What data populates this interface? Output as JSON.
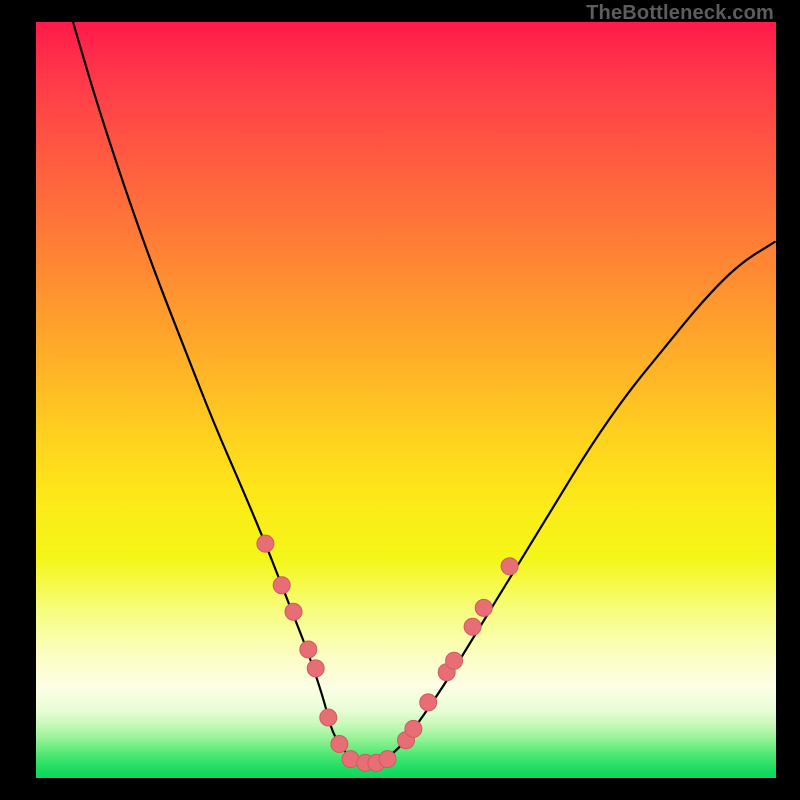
{
  "attribution": "TheBottleneck.com",
  "colors": {
    "background": "#000000",
    "curve": "#000000",
    "dot_fill": "#e76e74",
    "dot_stroke": "#d15a60"
  },
  "chart_data": {
    "type": "line",
    "title": "",
    "xlabel": "",
    "ylabel": "",
    "xlim": [
      0,
      100
    ],
    "ylim": [
      0,
      100
    ],
    "series": [
      {
        "name": "bottleneck-curve",
        "x": [
          5,
          8,
          12,
          16,
          20,
          24,
          28,
          31,
          33,
          35,
          37,
          39,
          40,
          42,
          44,
          46,
          48,
          50,
          55,
          60,
          65,
          70,
          75,
          80,
          85,
          90,
          95,
          100
        ],
        "y": [
          100,
          90,
          78,
          67,
          57,
          47,
          38,
          31,
          26,
          21,
          16,
          10,
          6,
          3,
          2,
          2,
          3,
          5,
          12,
          20,
          28,
          36,
          44,
          51,
          57,
          63,
          68,
          71
        ]
      }
    ],
    "markers": {
      "name": "highlight-dots",
      "points": [
        {
          "x": 31.0,
          "y": 31.0
        },
        {
          "x": 33.2,
          "y": 25.5
        },
        {
          "x": 34.8,
          "y": 22.0
        },
        {
          "x": 36.8,
          "y": 17.0
        },
        {
          "x": 37.8,
          "y": 14.5
        },
        {
          "x": 39.5,
          "y": 8.0
        },
        {
          "x": 41.0,
          "y": 4.5
        },
        {
          "x": 42.5,
          "y": 2.5
        },
        {
          "x": 44.5,
          "y": 2.0
        },
        {
          "x": 46.0,
          "y": 2.0
        },
        {
          "x": 47.5,
          "y": 2.5
        },
        {
          "x": 50.0,
          "y": 5.0
        },
        {
          "x": 51.0,
          "y": 6.5
        },
        {
          "x": 53.0,
          "y": 10.0
        },
        {
          "x": 55.5,
          "y": 14.0
        },
        {
          "x": 56.5,
          "y": 15.5
        },
        {
          "x": 59.0,
          "y": 20.0
        },
        {
          "x": 60.5,
          "y": 22.5
        },
        {
          "x": 64.0,
          "y": 28.0
        }
      ]
    }
  }
}
